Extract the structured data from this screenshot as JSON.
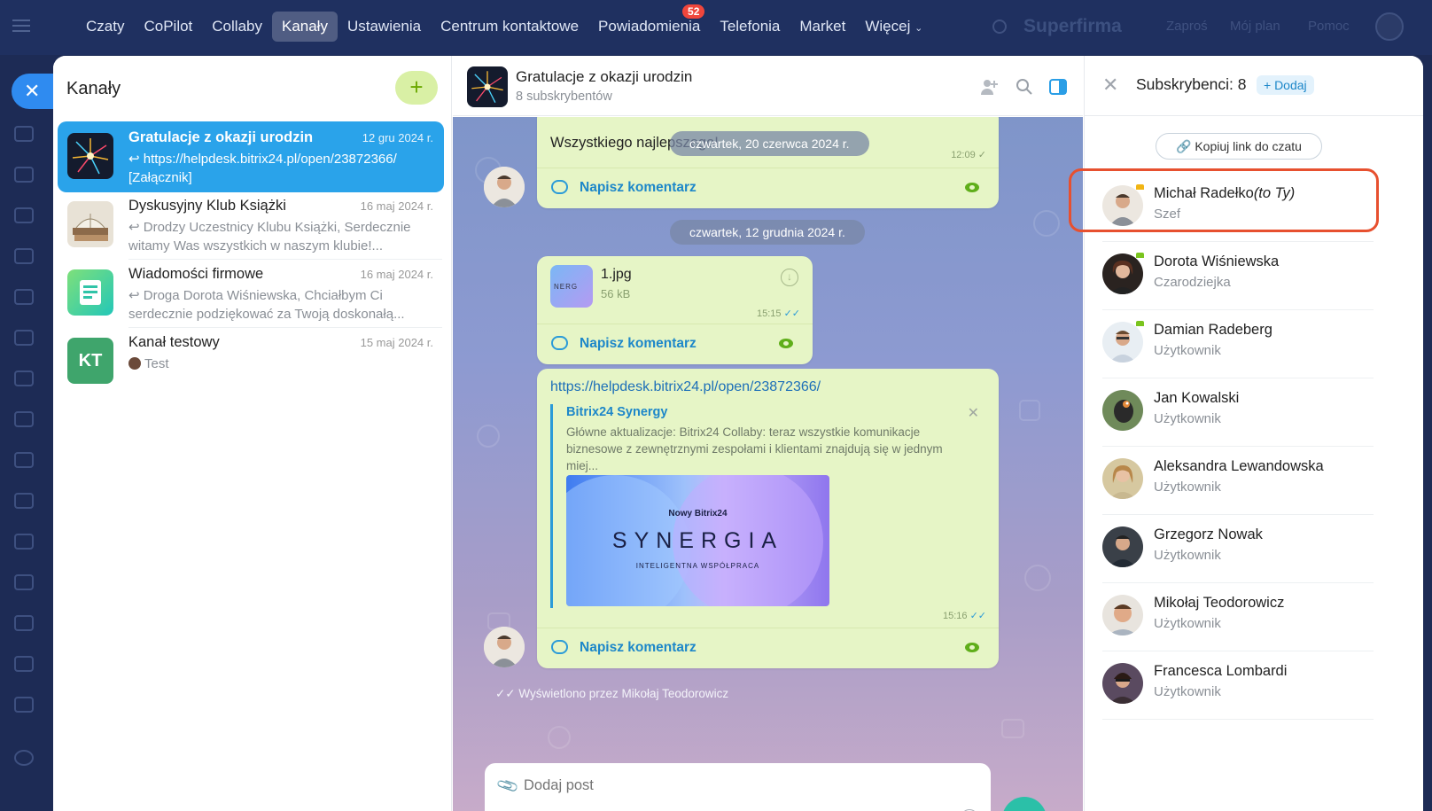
{
  "topnav": {
    "items": [
      "Czaty",
      "CoPilot",
      "Collaby",
      "Kanały",
      "Ustawienia",
      "Centrum kontaktowe",
      "Powiadomienia",
      "Telefonia",
      "Market",
      "Więcej"
    ],
    "active": "Kanały",
    "notif_badge": "52",
    "brand": "Superfirma",
    "right_links": [
      "Zaproś",
      "Mój plan",
      "Pomoc"
    ]
  },
  "channels": {
    "title": "Kanały",
    "add_label": "+",
    "items": [
      {
        "name": "Gratulacje z okazji urodzin",
        "date": "12 gru 2024 r.",
        "preview": "↩ https://helpdesk.bitrix24.pl/open/23872366/ [Załącznik]"
      },
      {
        "name": "Dyskusyjny Klub Książki",
        "date": "16 maj 2024 r.",
        "preview": "↩ Drodzy Uczestnicy Klubu Książki, Serdecznie witamy Was wszystkich w naszym klubie!..."
      },
      {
        "name": "Wiadomości firmowe",
        "date": "16 maj 2024 r.",
        "preview": "↩ Droga Dorota Wiśniewska, Chciałbym Ci serdecznie podziękować za Twoją doskonałą..."
      },
      {
        "name": "Kanał testowy",
        "date": "15 maj 2024 r.",
        "initials": "KT",
        "preview": "Test"
      }
    ]
  },
  "chat": {
    "title": "Gratulacje z okazji urodzin",
    "subtitle": "8 subskrybentów",
    "msg1_text": "Wszystkiego najlepszego!",
    "msg1_time": "12:09",
    "date1": "czwartek, 20 czerwca 2024 r.",
    "date2": "czwartek, 12 grudnia 2024 r.",
    "comment_label": "Napisz komentarz",
    "file_name": "1.jpg",
    "file_size": "56 kB",
    "file_time": "15:15",
    "link_url": "https://helpdesk.bitrix24.pl/open/23872366/",
    "preview_title": "Bitrix24 Synergy",
    "preview_desc": "Główne aktualizacje: Bitrix24 Collaby: teraz wszystkie komunikacje biznesowe z zewnętrznymi zespołami i klientami znajdują się w jednym miej...",
    "synergy_top": "Nowy Bitrix24",
    "synergy_word": "SYNERGIA",
    "synergy_sub": "INTELIGENTNA WSPÓŁPRACA",
    "link_time": "15:16",
    "seen_by": "Wyświetlono przez Mikołaj Teodorowicz",
    "input_placeholder": "Dodaj post"
  },
  "subscribers": {
    "title": "Subskrybenci: 8",
    "add_label": "+ Dodaj",
    "copy_link": "Kopiuj link do czatu",
    "items": [
      {
        "name": "Michał Radełko",
        "self_tag": "(to Ty)",
        "role": "Szef"
      },
      {
        "name": "Dorota Wiśniewska",
        "role": "Czarodziejka"
      },
      {
        "name": "Damian Radeberg",
        "role": "Użytkownik"
      },
      {
        "name": "Jan Kowalski",
        "role": "Użytkownik"
      },
      {
        "name": "Aleksandra Lewandowska",
        "role": "Użytkownik"
      },
      {
        "name": "Grzegorz Nowak",
        "role": "Użytkownik"
      },
      {
        "name": "Mikołaj Teodorowicz",
        "role": "Użytkownik"
      },
      {
        "name": "Francesca Lombardi",
        "role": "Użytkownik"
      }
    ]
  },
  "colors": {
    "accent": "#2aa3ea",
    "bubble": "#e6f5c6",
    "highlight": "#e7502f",
    "send": "#2bc0a8"
  }
}
